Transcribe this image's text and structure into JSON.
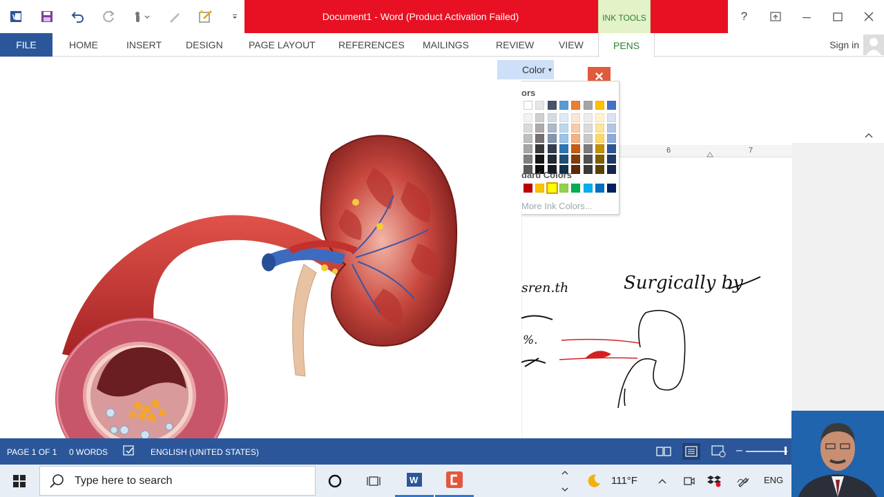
{
  "app": {
    "title": "Document1 -  Word (Product Activation Failed)",
    "contextual_group": "INK TOOLS",
    "sign_in": "Sign in"
  },
  "quick_access": [
    {
      "name": "word-logo-icon"
    },
    {
      "name": "save-icon"
    },
    {
      "name": "undo-icon"
    },
    {
      "name": "redo-icon"
    },
    {
      "name": "touch-mode-icon"
    },
    {
      "name": "pen-icon"
    },
    {
      "name": "draw-icon"
    },
    {
      "name": "customize-qat-icon"
    }
  ],
  "window_controls": {
    "help": "?",
    "minimize": "–",
    "maximize": "□",
    "close": "✕"
  },
  "tabs": [
    {
      "label": "FILE",
      "id": "file"
    },
    {
      "label": "HOME",
      "id": "home"
    },
    {
      "label": "INSERT",
      "id": "insert"
    },
    {
      "label": "DESIGN",
      "id": "design"
    },
    {
      "label": "PAGE LAYOUT",
      "id": "page-layout"
    },
    {
      "label": "REFERENCES",
      "id": "references"
    },
    {
      "label": "MAILINGS",
      "id": "mailings"
    },
    {
      "label": "REVIEW",
      "id": "review"
    },
    {
      "label": "VIEW",
      "id": "view"
    },
    {
      "label": "PENS",
      "id": "pens",
      "active": true
    }
  ],
  "ruler": {
    "marks": [
      "6",
      "7"
    ]
  },
  "color_dropdown": {
    "button_label": "Color",
    "theme_header": "ors",
    "standard_header": "dard Colors",
    "more_colors": "More Ink Colors...",
    "theme_top": [
      "#ffffff",
      "#e7e6e6",
      "#44546a",
      "#5b9bd5",
      "#ed7d31",
      "#a5a5a5",
      "#ffc000",
      "#4472c4",
      "#70ad47"
    ],
    "theme_shades": [
      [
        "#f2f2f2",
        "#d9d9d9",
        "#bfbfbf",
        "#a6a6a6",
        "#808080",
        "#595959"
      ],
      [
        "#d0cece",
        "#aeaaaa",
        "#757171",
        "#3a3838",
        "#171616",
        "#0d0d0d"
      ],
      [
        "#d6dce4",
        "#adb9ca",
        "#8496b0",
        "#333f4f",
        "#222a35",
        "#161c23"
      ],
      [
        "#deebf6",
        "#bdd7ee",
        "#9dc3e6",
        "#2e75b5",
        "#1f4e79",
        "#12304a"
      ],
      [
        "#fbe5d5",
        "#f7cbac",
        "#f4b183",
        "#c55a11",
        "#833c0b",
        "#5a2907"
      ],
      [
        "#ededed",
        "#dbdbdb",
        "#c9c9c9",
        "#7b7b7b",
        "#525252",
        "#3a3a3a"
      ],
      [
        "#fff2cc",
        "#fee599",
        "#ffd965",
        "#bf9000",
        "#7f6000",
        "#594300"
      ],
      [
        "#dae3f3",
        "#b4c6e7",
        "#8eaadb",
        "#2f5496",
        "#1f3864",
        "#15264a"
      ],
      [
        "#e2efd9",
        "#c5e0b3",
        "#a8d08d",
        "#538135",
        "#375623",
        "#263c18"
      ]
    ],
    "standard": [
      "#c00000",
      "#ffc000",
      "#ffff00",
      "#92d050",
      "#00b050",
      "#00b0f0",
      "#0070c0",
      "#002060",
      "#7030a0"
    ],
    "selected_standard_index": 2
  },
  "ink_text": {
    "line1": "Surgically by",
    "fragment1": "sren.th",
    "fragment2": "%."
  },
  "status": {
    "page": "PAGE 1 OF 1",
    "words": "0 WORDS",
    "language": "ENGLISH (UNITED STATES)"
  },
  "taskbar": {
    "search_placeholder": "Type here to search",
    "temperature": "111°F",
    "language": "ENG"
  },
  "colors": {
    "word_blue": "#2b579a",
    "title_red": "#e81123",
    "ink_tools_green": "#2e7d32",
    "ink_tools_bg": "#e3f2c8"
  }
}
